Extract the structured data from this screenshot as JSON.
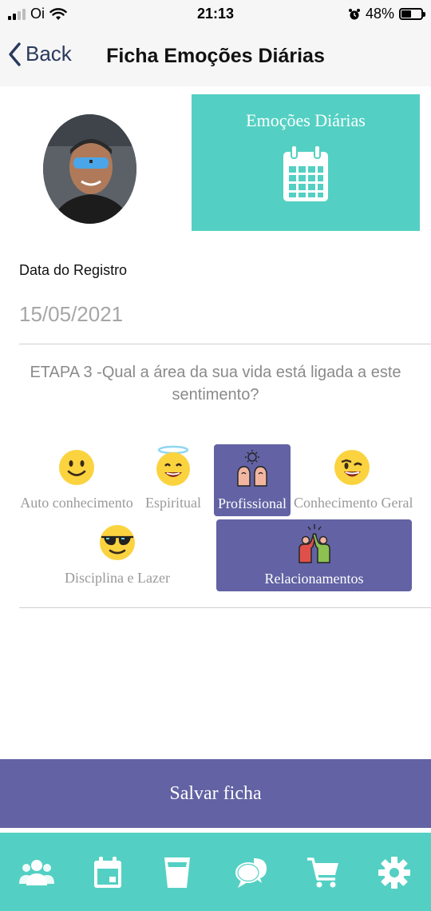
{
  "status_bar": {
    "carrier": "Oi",
    "time": "21:13",
    "battery_percent": "48%",
    "battery_level": 0.48,
    "icons": [
      "signal-icon",
      "wifi-icon",
      "alarm-icon",
      "battery-icon"
    ]
  },
  "nav": {
    "back_label": "Back",
    "title": "Ficha Emoções Diárias"
  },
  "daily_card": {
    "title": "Emoções Diárias",
    "icon": "calendar-icon"
  },
  "form": {
    "date_label": "Data do Registro",
    "date_value": "15/05/2021",
    "question": "ETAPA 3 -Qual a área da sua vida está ligada a este sentimento?"
  },
  "areas": [
    {
      "label": "Auto conhecimento",
      "icon": "smile-emoji-icon",
      "selected": false
    },
    {
      "label": "Espiritual",
      "icon": "angel-emoji-icon",
      "selected": false
    },
    {
      "label": "Profissional",
      "icon": "professional-icon",
      "selected": true
    },
    {
      "label": "Conhecimento Geral",
      "icon": "wink-emoji-icon",
      "selected": false
    },
    {
      "label": "Disciplina e Lazer",
      "icon": "sunglasses-emoji-icon",
      "selected": false
    },
    {
      "label": "Relacionamentos",
      "icon": "high-five-icon",
      "selected": true
    }
  ],
  "save_button": {
    "label": "Salvar ficha"
  },
  "tab_bar": {
    "tabs": [
      "group-icon",
      "calendar-icon",
      "glass-icon",
      "chat-icon",
      "cart-icon",
      "gear-icon"
    ]
  },
  "colors": {
    "teal": "#53d0c3",
    "purple": "#6262a4",
    "emoji_yellow": "#fbd33f"
  }
}
